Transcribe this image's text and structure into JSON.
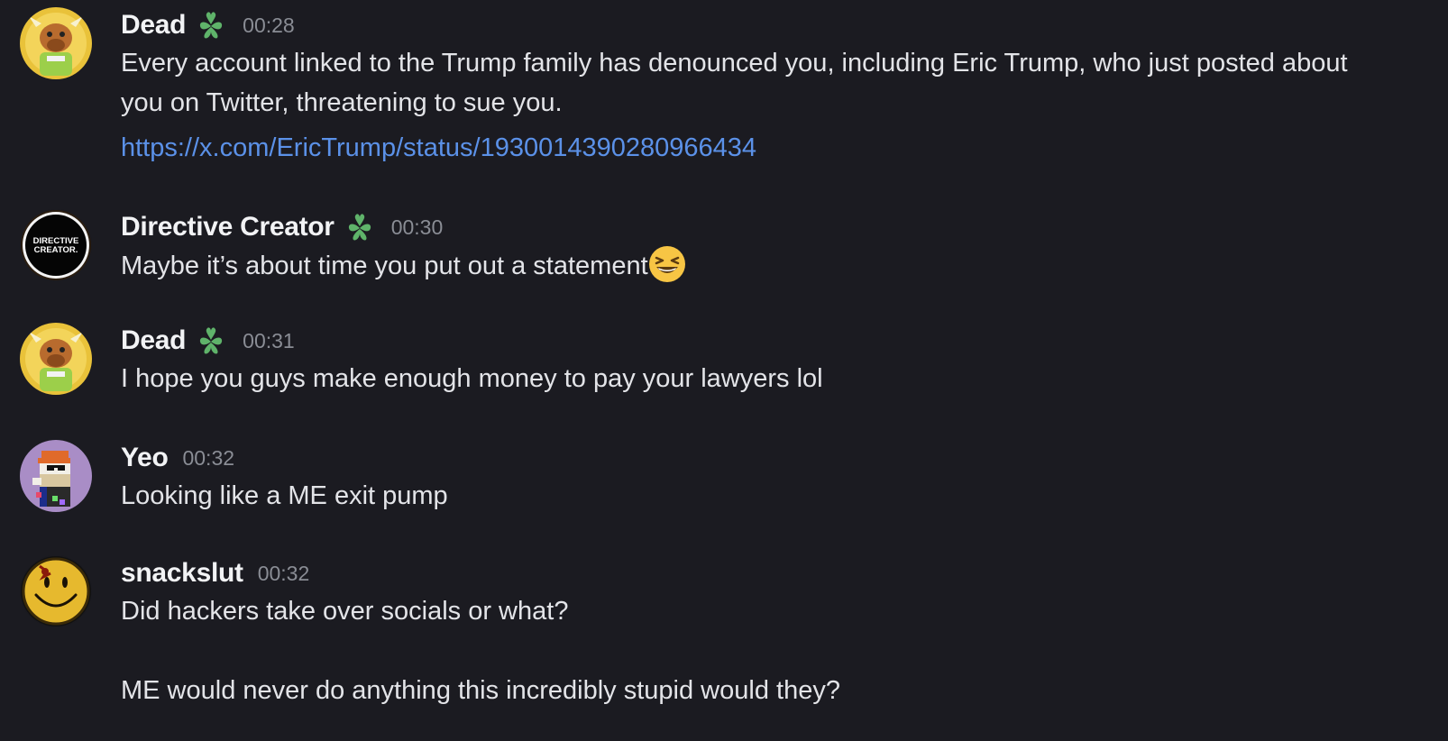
{
  "messages": [
    {
      "username": "Dead",
      "time": "00:28",
      "lines": [
        "Every account linked to the Trump family has denounced you, including Eric Trump, who just posted about you on Twitter, threatening to sue you."
      ],
      "link": "https://x.com/EricTrump/status/1930014390280966434",
      "avatar": "bull-avatar",
      "role_icon": "leaf-heart-icon"
    },
    {
      "username": "Directive Creator",
      "time": "00:30",
      "lines": [
        "Maybe it’s about time you put out a statement"
      ],
      "emoji": "laughing-face-emoji",
      "avatar_text": [
        "DIRECTIVE",
        "CREATOR."
      ],
      "role_icon": "leaf-heart-icon"
    },
    {
      "username": "Dead",
      "time": "00:31",
      "lines": [
        "I hope you guys make enough money to pay your lawyers lol"
      ],
      "avatar": "bull-avatar",
      "role_icon": "leaf-heart-icon"
    },
    {
      "username": "Yeo",
      "time": "00:32",
      "lines": [
        "Looking like a ME exit pump"
      ],
      "avatar": "pixel-avatar"
    },
    {
      "username": "snackslut",
      "time": "00:32",
      "lines": [
        "Did hackers take over socials or what?",
        "ME would never do anything this incredibly stupid would they?"
      ],
      "avatar": "smiley-avatar"
    }
  ],
  "colors": {
    "background": "#1b1b21",
    "username": "#f2f3f5",
    "timestamp": "#8a8d95",
    "text": "#e3e4e8",
    "link": "#5b91e8",
    "role_icon": "#5fb36a"
  }
}
